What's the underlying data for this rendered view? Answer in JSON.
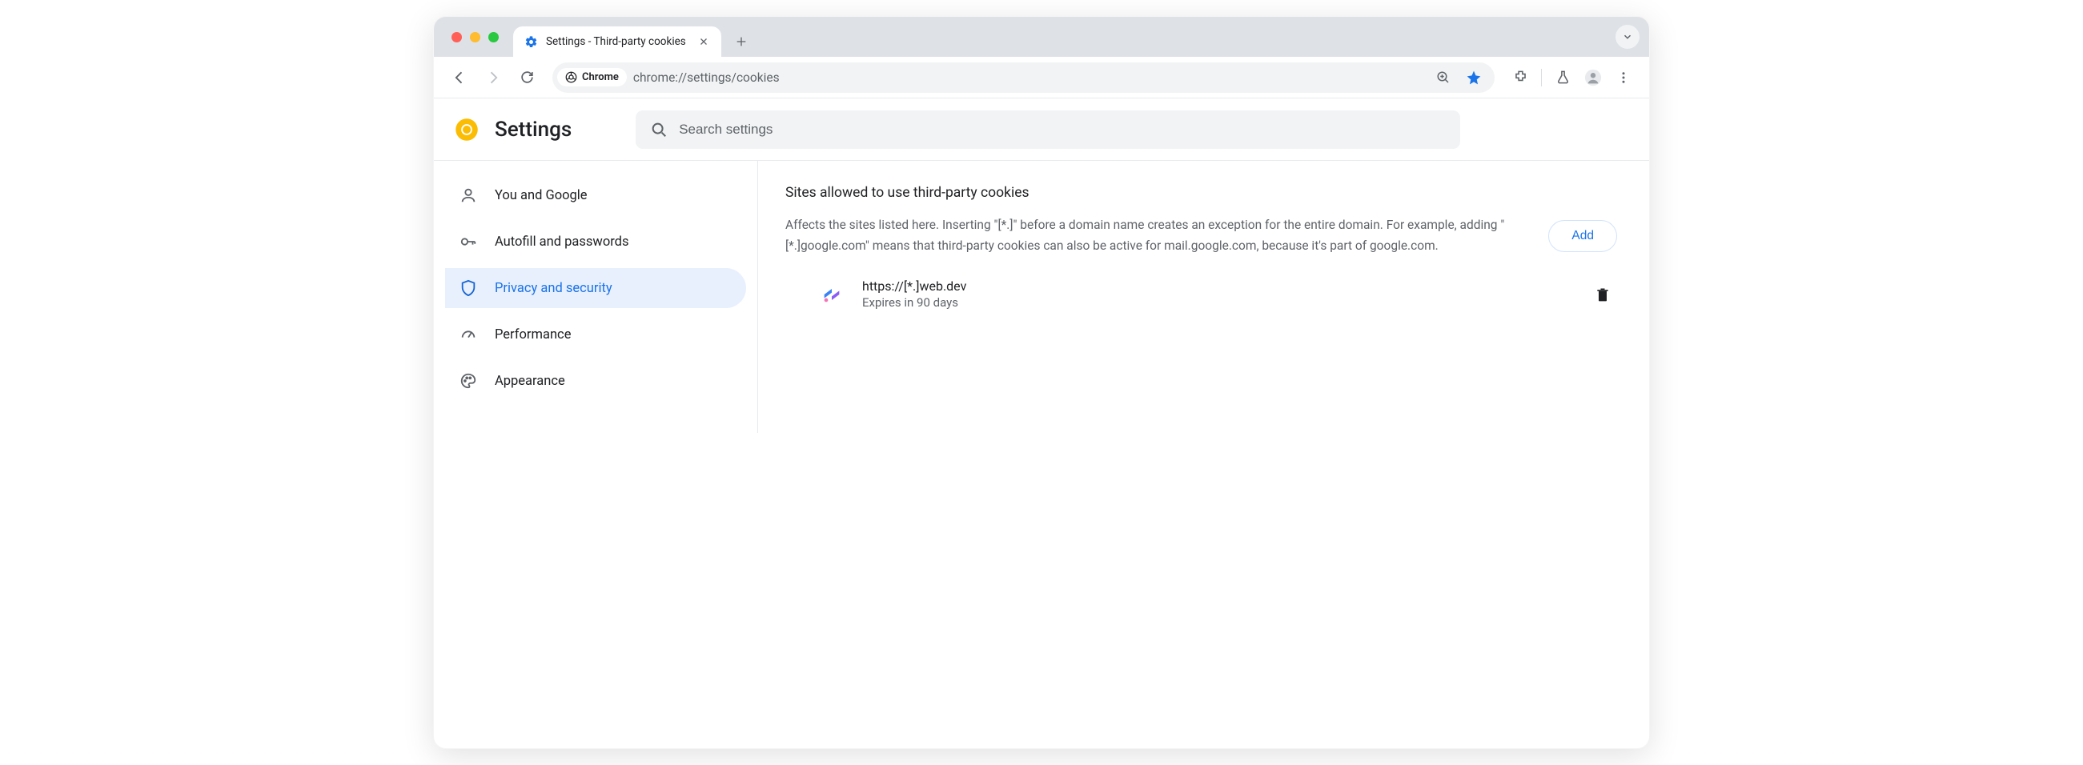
{
  "browser": {
    "tab_title": "Settings - Third-party cookies",
    "url": "chrome://settings/cookies",
    "chip_label": "Chrome"
  },
  "header": {
    "title": "Settings",
    "search_placeholder": "Search settings"
  },
  "sidebar": {
    "items": [
      {
        "label": "You and Google"
      },
      {
        "label": "Autofill and passwords"
      },
      {
        "label": "Privacy and security"
      },
      {
        "label": "Performance"
      },
      {
        "label": "Appearance"
      }
    ]
  },
  "main": {
    "section_title": "Sites allowed to use third-party cookies",
    "section_desc": "Affects the sites listed here. Inserting \"[*.]\" before a domain name creates an exception for the entire domain. For example, adding \"[*.]google.com\" means that third-party cookies can also be active for mail.google.com, because it's part of google.com.",
    "add_label": "Add",
    "sites": [
      {
        "url": "https://[*.]web.dev",
        "expiry": "Expires in 90 days"
      }
    ]
  }
}
